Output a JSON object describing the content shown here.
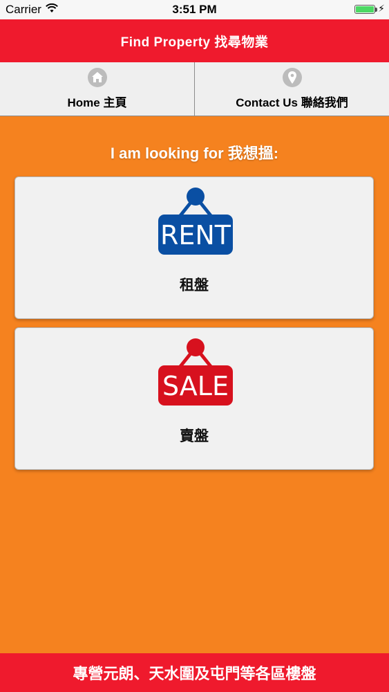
{
  "status_bar": {
    "carrier": "Carrier",
    "time": "3:51 PM"
  },
  "header": {
    "title": "Find Property 找尋物業"
  },
  "nav": {
    "tabs": [
      {
        "label": "Home 主頁",
        "icon": "home-icon"
      },
      {
        "label": "Contact Us 聯絡我們",
        "icon": "location-pin-icon"
      }
    ]
  },
  "main": {
    "prompt": "I am looking for 我想搵:",
    "options": [
      {
        "sign_text": "RENT",
        "label": "租盤",
        "color": "#0a4fa3"
      },
      {
        "sign_text": "SALE",
        "label": "賣盤",
        "color": "#d7111e"
      }
    ]
  },
  "footer": {
    "text": "專營元朗、天水圍及屯門等各區樓盤"
  },
  "colors": {
    "background": "#f5821f",
    "accent": "#ef1a2d",
    "nav_bg": "#efefef"
  }
}
